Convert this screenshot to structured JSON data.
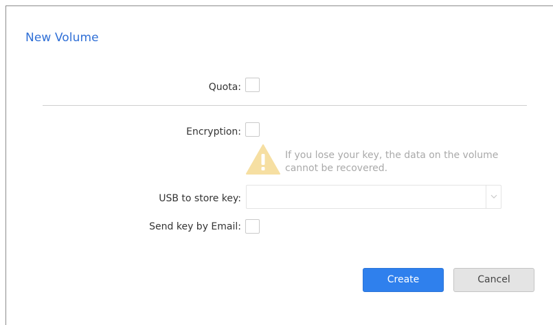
{
  "dialog": {
    "title": "New Volume"
  },
  "quota": {
    "label": "Quota:",
    "checked": false
  },
  "encryption": {
    "label": "Encryption:",
    "checked": false,
    "warning_icon": "warning-triangle-icon",
    "warning_text": "If you lose your key, the data on the volume cannot be recovered."
  },
  "usb_key": {
    "label": "USB to store key:",
    "selected_value": "",
    "arrow_icon": "chevron-down-icon"
  },
  "email_key": {
    "label": "Send key by Email:",
    "checked": false
  },
  "actions": {
    "create_label": "Create",
    "cancel_label": "Cancel"
  },
  "colors": {
    "title": "#2f6fd6",
    "primary_button": "#2f80ed",
    "secondary_button": "#e4e4e4",
    "warning_icon": "#f6dfa2",
    "muted_text": "#a9a9a9"
  }
}
